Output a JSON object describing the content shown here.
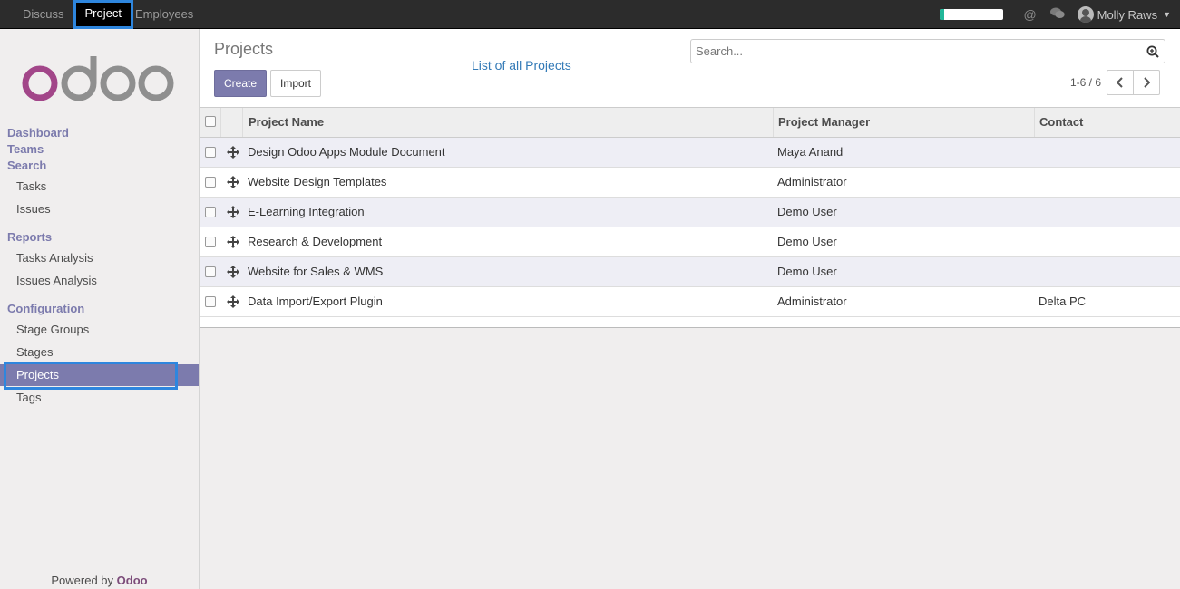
{
  "topbar": {
    "menu": [
      "Discuss",
      "Project",
      "Employees"
    ],
    "active_menu": "Project",
    "progress": 0.07,
    "icons": [
      "at-icon",
      "chat-icon"
    ],
    "user": "Molly Raws"
  },
  "sidebar": {
    "logo": "odoo",
    "sections": {
      "dashboard": "Dashboard",
      "teams": "Teams",
      "search": "Search",
      "reports": "Reports",
      "configuration": "Configuration"
    },
    "items": {
      "tasks": "Tasks",
      "issues": "Issues",
      "tasks_analysis": "Tasks Analysis",
      "issues_analysis": "Issues Analysis",
      "stage_groups": "Stage Groups",
      "stages": "Stages",
      "projects": "Projects",
      "tags": "Tags"
    },
    "powered_prefix": "Powered by",
    "powered_brand": "Odoo"
  },
  "control": {
    "title": "Projects",
    "create": "Create",
    "import": "Import",
    "all_link": "List of all Projects",
    "search_placeholder": "Search...",
    "pager": "1-6 / 6"
  },
  "table": {
    "headers": [
      "Project Name",
      "Project Manager",
      "Contact"
    ],
    "rows": [
      [
        "Design Odoo Apps Module Document",
        "Maya Anand",
        ""
      ],
      [
        "Website Design Templates",
        "Administrator",
        ""
      ],
      [
        "E-Learning Integration",
        "Demo User",
        ""
      ],
      [
        "Research & Development",
        "Demo User",
        ""
      ],
      [
        "Website for Sales & WMS",
        "Demo User",
        ""
      ],
      [
        "Data Import/Export Plugin",
        "Administrator",
        "Delta PC"
      ]
    ]
  },
  "colors": {
    "accent": "#7c7bad",
    "highlight": "#2e86de",
    "topbar": "#2c2c2c",
    "link": "#337ab7"
  }
}
